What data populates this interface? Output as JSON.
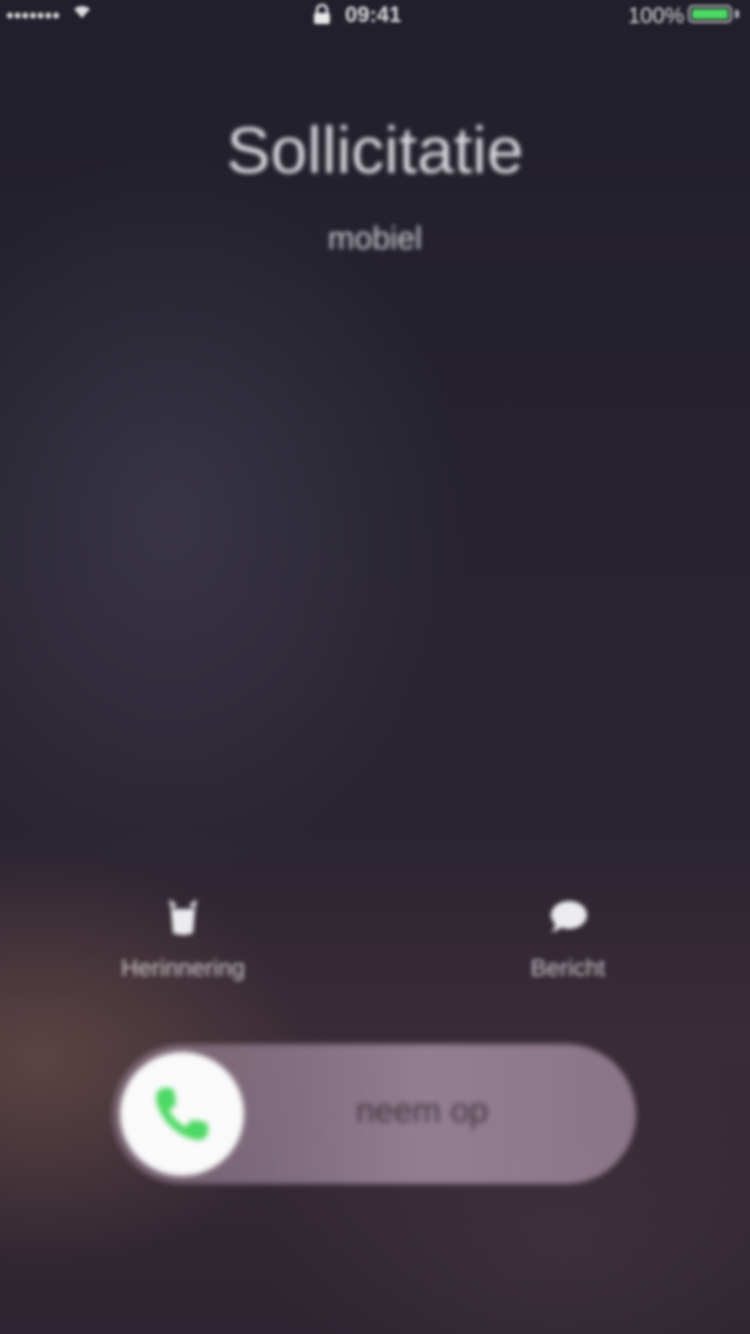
{
  "status_bar": {
    "carrier": "•••••••",
    "time": "09:41",
    "battery": "100%",
    "icons": [
      "wifi-icon",
      "lock-icon",
      "battery-icon"
    ],
    "battery_color": "#4cd964"
  },
  "caller": {
    "name": "Sollicitatie",
    "label": "mobiel"
  },
  "actions": {
    "remind_label": "Herinnering",
    "remind_icon": "alarm-clock-icon",
    "message_label": "Bericht",
    "message_icon": "message-bubble-icon"
  },
  "slider": {
    "label": "neem op",
    "icon": "phone-icon",
    "icon_color": "#4cd964"
  }
}
